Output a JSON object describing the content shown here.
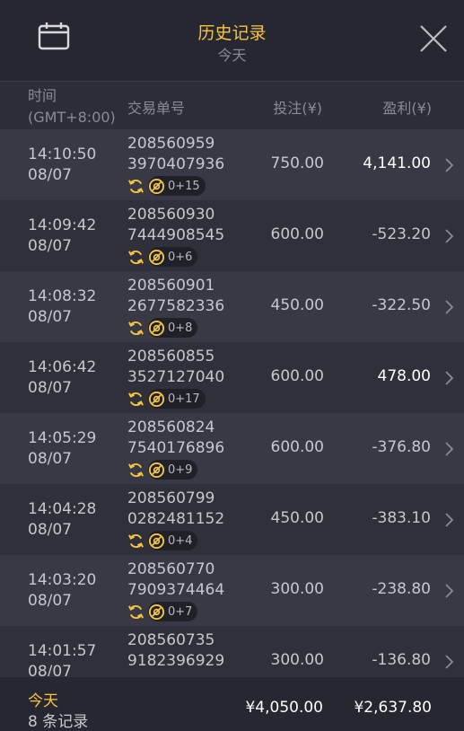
{
  "header": {
    "title": "历史记录",
    "subtitle": "今天"
  },
  "columns": {
    "time_line1": "时间",
    "time_line2": "(GMT+8:00)",
    "order": "交易单号",
    "bet": "投注(¥)",
    "profit": "盈利(¥)"
  },
  "rows": [
    {
      "time": "14:10:50",
      "date": "08/07",
      "order1": "208560959",
      "order2": "3970407936",
      "badge": "0+15",
      "bet": "750.00",
      "profit": "4,141.00",
      "win": true
    },
    {
      "time": "14:09:42",
      "date": "08/07",
      "order1": "208560930",
      "order2": "7444908545",
      "badge": "0+6",
      "bet": "600.00",
      "profit": "-523.20",
      "win": false
    },
    {
      "time": "14:08:32",
      "date": "08/07",
      "order1": "208560901",
      "order2": "2677582336",
      "badge": "0+8",
      "bet": "450.00",
      "profit": "-322.50",
      "win": false
    },
    {
      "time": "14:06:42",
      "date": "08/07",
      "order1": "208560855",
      "order2": "3527127040",
      "badge": "0+17",
      "bet": "600.00",
      "profit": "478.00",
      "win": true
    },
    {
      "time": "14:05:29",
      "date": "08/07",
      "order1": "208560824",
      "order2": "7540176896",
      "badge": "0+9",
      "bet": "600.00",
      "profit": "-376.80",
      "win": false
    },
    {
      "time": "14:04:28",
      "date": "08/07",
      "order1": "208560799",
      "order2": "0282481152",
      "badge": "0+4",
      "bet": "450.00",
      "profit": "-383.10",
      "win": false
    },
    {
      "time": "14:03:20",
      "date": "08/07",
      "order1": "208560770",
      "order2": "7909374464",
      "badge": "0+7",
      "bet": "300.00",
      "profit": "-238.80",
      "win": false
    },
    {
      "time": "14:01:57",
      "date": "08/07",
      "order1": "208560735",
      "order2": "9182396929",
      "badge": "",
      "bet": "300.00",
      "profit": "-136.80",
      "win": false
    }
  ],
  "footer": {
    "label": "今天",
    "count": "8 条记录",
    "total_bet": "¥4,050.00",
    "total_profit": "¥2,637.80"
  },
  "colors": {
    "accent": "#f5c542",
    "win": "#ffffff",
    "text": "#c7c7cf",
    "muted": "#8a8a94"
  },
  "icons": {
    "calendar": "calendar-icon",
    "close": "close-icon",
    "refresh": "refresh-icon",
    "bonus": "bonus-icon",
    "chevron": "chevron-right-icon"
  }
}
